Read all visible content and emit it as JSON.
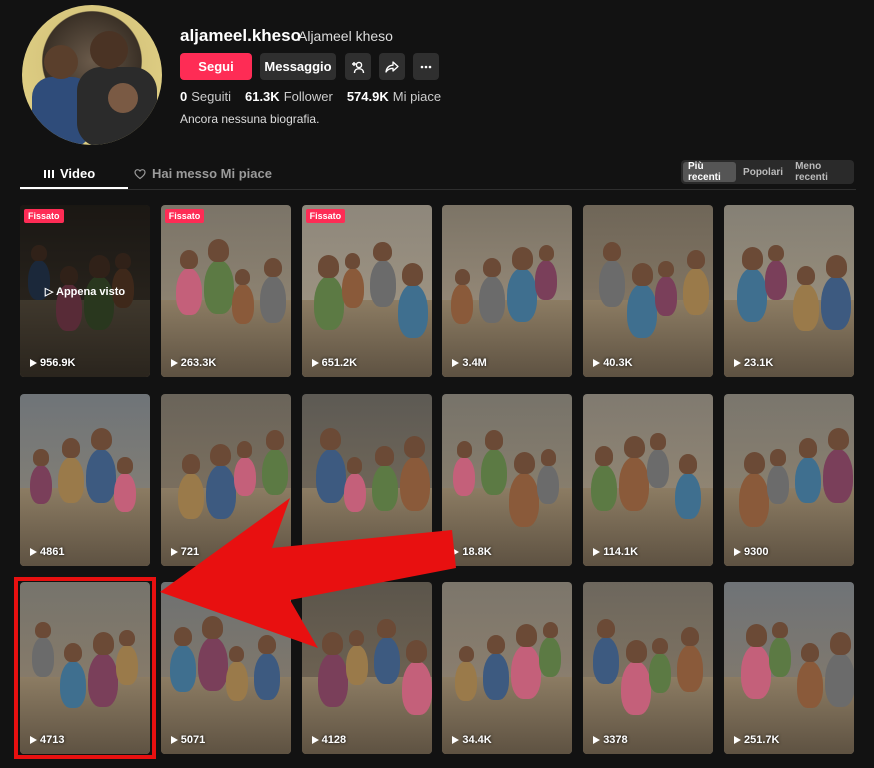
{
  "profile": {
    "username": "aljameel.kheso",
    "nickname": "Aljameel kheso",
    "follow_label": "Segui",
    "message_label": "Messaggio",
    "stats": [
      {
        "value": "0",
        "label": "Seguiti"
      },
      {
        "value": "61.3K",
        "label": "Follower"
      },
      {
        "value": "574.9K",
        "label": "Mi piace"
      }
    ],
    "bio": "Ancora nessuna biografia."
  },
  "tabs": {
    "video": "Video",
    "liked": "Hai messo Mi piace"
  },
  "sort": {
    "recent": "Più recenti",
    "popular": "Popolari",
    "oldest": "Meno recenti"
  },
  "videos": [
    {
      "views": "956.9K",
      "pinned": "Fissato",
      "overlay": "Appena visto"
    },
    {
      "views": "263.3K",
      "pinned": "Fissato"
    },
    {
      "views": "651.2K",
      "pinned": "Fissato"
    },
    {
      "views": "3.4M"
    },
    {
      "views": "40.3K"
    },
    {
      "views": "23.1K"
    },
    {
      "views": "4861"
    },
    {
      "views": "721"
    },
    {
      "views": ""
    },
    {
      "views": "18.8K"
    },
    {
      "views": "114.1K"
    },
    {
      "views": "9300"
    },
    {
      "views": "4713"
    },
    {
      "views": "5071"
    },
    {
      "views": "4128"
    },
    {
      "views": "34.4K"
    },
    {
      "views": "3378"
    },
    {
      "views": "251.7K"
    }
  ],
  "colors": {
    "accent": "#fe2c55",
    "annotation": "#e81010",
    "background": "#121212"
  }
}
